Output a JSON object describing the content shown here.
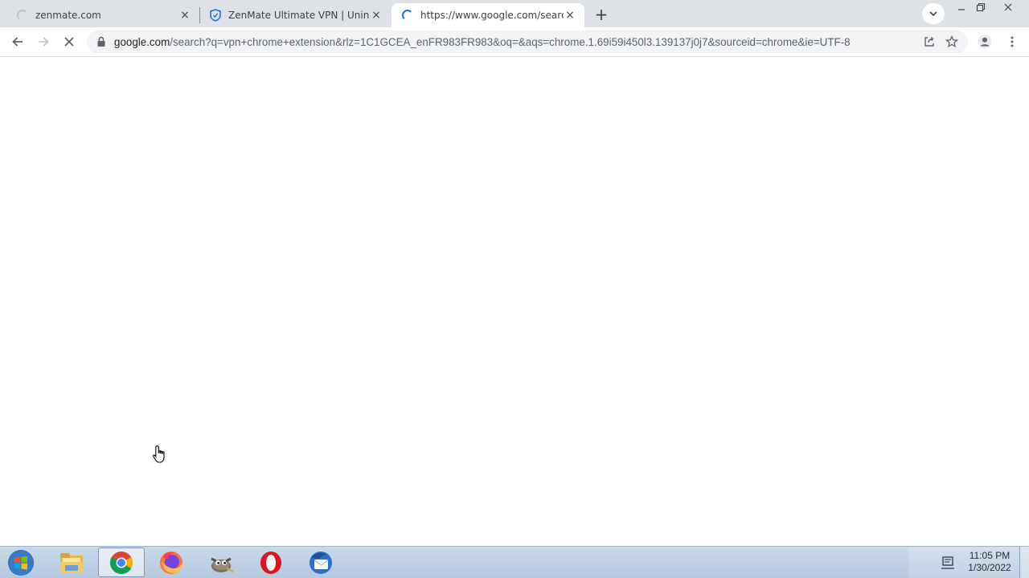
{
  "tabs": [
    {
      "title": "zenmate.com",
      "favicon": "loading-spinner-grey",
      "close": "×"
    },
    {
      "title": "ZenMate Ultimate VPN | Uninstal",
      "favicon": "zenmate-shield-icon",
      "close": "×"
    },
    {
      "title": "https://www.google.com/search?",
      "favicon": "loading-spinner-blue",
      "close": "×",
      "active": true
    }
  ],
  "new_tab": "+",
  "omnibox": {
    "host": "google.com",
    "rest": "/search?q=vpn+chrome+extension&rlz=1C1GCEA_enFR983FR983&oq=&aqs=chrome.1.69i59i450l3.139137j0j7&sourceid=chrome&ie=UTF-8"
  },
  "taskbar": {
    "apps": [
      "windows-explorer-icon",
      "chrome-icon",
      "firefox-icon",
      "gimp-icon",
      "opera-icon",
      "thunderbird-icon"
    ],
    "active_app": "chrome-icon"
  },
  "clock": {
    "time": "11:05 PM",
    "date": "1/30/2022"
  },
  "colors": {
    "tabstrip": "#dee1e6",
    "accent": "#1a73e8",
    "taskbar": "#c9d9ea"
  }
}
